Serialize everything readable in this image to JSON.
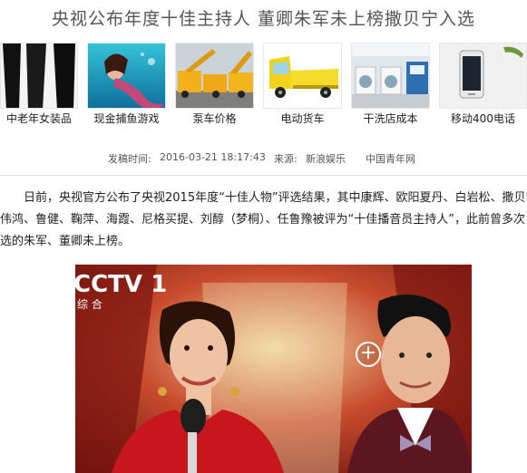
{
  "article": {
    "title": "央视公布年度十佳主持人 董卿朱军未上榜撒贝宁入选",
    "date_label": "发稿时间:",
    "date_value": "2016-03-21 18:17:43",
    "source_label": "来源:",
    "source_value": "新浪娱乐",
    "source_org": "中国青年网",
    "body_lines": [
      "日前，央视官方公布了央视2015年度“十佳人物”评选结果，其中康辉、欧阳夏丹、白岩松、撒贝宁、",
      "伟鸿、鲁健、鞠萍、海霞、尼格买提、刘醇（梦桐）、任鲁豫被评为“十佳播音员主持人”，此前曾多次",
      "选的朱军、董卿未上榜。"
    ]
  },
  "ads": [
    {
      "label": "中老年女装品",
      "icon": "pants-photo"
    },
    {
      "label": "现金捕鱼游戏",
      "icon": "mermaid-photo"
    },
    {
      "label": "泵车价格",
      "icon": "pump-truck-photo"
    },
    {
      "label": "电动货车",
      "icon": "electric-truck-photo"
    },
    {
      "label": "干洗店成本",
      "icon": "laundry-photo"
    },
    {
      "label": "移动400电话",
      "icon": "phone-photo"
    }
  ],
  "photo": {
    "channel_logo": "CCTV 1",
    "channel_sub": "综 合",
    "zoom_symbol": "+"
  },
  "colors": {
    "stage_red": "#8a1a14",
    "brand_white": "#ffffff"
  }
}
